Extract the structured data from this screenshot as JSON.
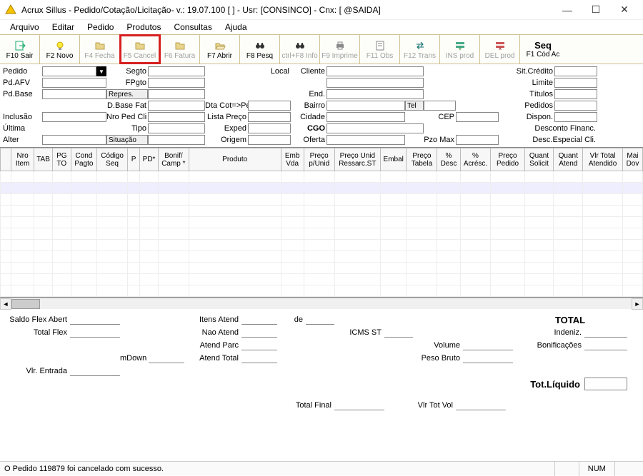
{
  "title": "Acrux Sillus - Pedido/Cotação/Licitação- v.: 19.07.100  [               ] - Usr: [CONSINCO] - Cnx: [             @SAIDA]",
  "menu": {
    "items": [
      "Arquivo",
      "Editar",
      "Pedido",
      "Produtos",
      "Consultas",
      "Ajuda"
    ]
  },
  "toolbar": {
    "buttons": [
      {
        "label": "F10 Sair",
        "icon": "exit",
        "enabled": true
      },
      {
        "label": "F2 Novo",
        "icon": "bulb",
        "enabled": true
      },
      {
        "label": "F4 Fecha",
        "icon": "folder",
        "enabled": false
      },
      {
        "label": "F5 Cancel",
        "icon": "folder",
        "enabled": false,
        "highlight": true
      },
      {
        "label": "F6 Fatura",
        "icon": "folder",
        "enabled": false
      },
      {
        "label": "F7 Abrir",
        "icon": "open",
        "enabled": true
      },
      {
        "label": "F8 Pesq",
        "icon": "binoc",
        "enabled": true
      },
      {
        "label": "ctrl+F8 Info",
        "icon": "binoc",
        "enabled": false
      },
      {
        "label": "F9 Imprime",
        "icon": "print",
        "enabled": false
      },
      {
        "label": "F11 Obs",
        "icon": "note",
        "enabled": false
      },
      {
        "label": "F12 Trans",
        "icon": "trans",
        "enabled": false
      },
      {
        "label": "INS prod",
        "icon": "ins",
        "enabled": false
      },
      {
        "label": "DEL prod",
        "icon": "del",
        "enabled": false
      }
    ],
    "seq": {
      "top": "Seq",
      "bottom": "F1 Cód Ac"
    }
  },
  "form": {
    "labels": {
      "pedido": "Pedido",
      "pdafv": "Pd.AFV",
      "pdbase": "Pd.Base",
      "inclusao": "Inclusão",
      "ultima": "Última",
      "alter": "Alter",
      "segto": "Segto",
      "fpgto": "FPgto",
      "repres": "Repres.",
      "dbasefat": "D.Base Fat",
      "nropedcli": "Nro Ped Cli",
      "tipo": "Tipo",
      "situacao": "Situação",
      "dtacotped": "Dta Cot=>Ped",
      "listapreco": "Lista Preço",
      "exped": "Exped",
      "origem": "Origem",
      "local": "Local",
      "cliente": "Cliente",
      "end": "End.",
      "bairro": "Bairro",
      "cidade": "Cidade",
      "cgo": "CGO",
      "oferta": "Oferta",
      "tel": "Tel",
      "cep": "CEP",
      "pzomax": "Pzo Max",
      "sitcredito": "Sit.Crédito",
      "limite": "Limite",
      "titulos": "Títulos",
      "pedidos": "Pedidos",
      "dispon": "Dispon.",
      "descfin": "Desconto Financ.",
      "descesp": "Desc.Especial Cli."
    }
  },
  "grid": {
    "columns": [
      "",
      "Nro Item",
      "TAB",
      "PG TO",
      "Cond Pagto",
      "Código Seq",
      "P",
      "PD*",
      "Bonif/ Camp *",
      "Produto",
      "Emb Vda",
      "Preço p/Unid",
      "Preço Unid Ressarc.ST",
      "Embal",
      "Preço Tabela",
      "% Desc",
      "% Acrésc.",
      "Preço Pedido",
      "Quant Solicit",
      "Quant Atend",
      "Vlr Total Atendido",
      "Mai Dov"
    ],
    "rows": 11
  },
  "summary": {
    "labels": {
      "saldoflex": "Saldo Flex Abert",
      "totalflex": "Total Flex",
      "mdown": "mDown",
      "vlrentrada": "Vlr. Entrada",
      "itensatend": "Itens Atend",
      "de": "de",
      "naoatend": "Nao Atend",
      "atendparc": "Atend Parc",
      "atendtotal": "Atend Total",
      "icmsst": "ICMS ST",
      "volume": "Volume",
      "pesobruto": "Peso Bruto",
      "total": "TOTAL",
      "indeniz": "Indeniz.",
      "bonific": "Bonificações",
      "totalfinal": "Total Final",
      "vlrtotvol": "Vlr Tot Vol",
      "totliquido": "Tot.Líquido"
    }
  },
  "status": {
    "message": "O Pedido 119879 foi cancelado com sucesso.",
    "num": "NUM"
  }
}
